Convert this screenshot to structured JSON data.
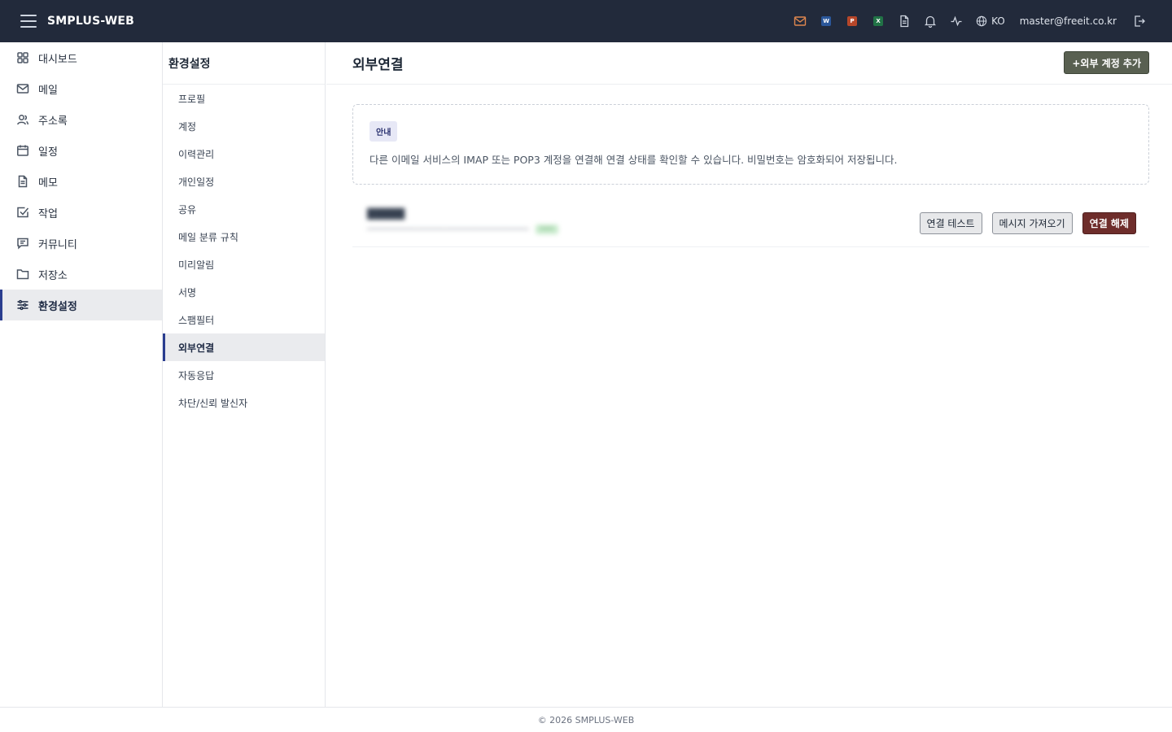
{
  "app": {
    "brand": "SMPLUS-WEB"
  },
  "topbar": {
    "word_letter": "W",
    "ppt_letter": "P",
    "excel_letter": "X",
    "language": "KO",
    "user_email": "master@freeit.co.kr",
    "colors": {
      "bg": "#222a3b",
      "mail_icon": "#e0874f",
      "word": "#2b579a",
      "ppt": "#b7472a",
      "excel": "#217346"
    }
  },
  "leftnav": {
    "items": [
      {
        "label": "대시보드",
        "icon": "grid-icon"
      },
      {
        "label": "메일",
        "icon": "mail-icon"
      },
      {
        "label": "주소록",
        "icon": "users-icon"
      },
      {
        "label": "일정",
        "icon": "calendar-icon"
      },
      {
        "label": "메모",
        "icon": "memo-icon"
      },
      {
        "label": "작업",
        "icon": "check-square-icon"
      },
      {
        "label": "커뮤니티",
        "icon": "chat-icon"
      },
      {
        "label": "저장소",
        "icon": "folder-icon"
      },
      {
        "label": "환경설정",
        "icon": "sliders-icon",
        "active": true
      }
    ]
  },
  "subnav": {
    "title": "환경설정",
    "items": [
      {
        "label": "프로필"
      },
      {
        "label": "계정"
      },
      {
        "label": "이력관리"
      },
      {
        "label": "개인일정"
      },
      {
        "label": "공유"
      },
      {
        "label": "메일 분류 규칙"
      },
      {
        "label": "미리알림"
      },
      {
        "label": "서명"
      },
      {
        "label": "스팸필터"
      },
      {
        "label": "외부연결",
        "active": true
      },
      {
        "label": "자동응답"
      },
      {
        "label": "차단/신뢰 발신자"
      }
    ]
  },
  "main": {
    "title": "외부연결",
    "add_button": "+외부 계정 추가",
    "notice": {
      "badge": "안내",
      "text": "다른 이메일 서비스의 IMAP 또는 POP3 계정을 연결해 연결 상태를 확인할 수 있습니다. 비밀번호는 암호화되어 저장됩니다."
    },
    "account": {
      "name": "",
      "meta": "",
      "status": "",
      "actions": {
        "test": "연결 테스트",
        "fetch": "메시지 가져오기",
        "disconnect": "연결 해제"
      }
    }
  },
  "footer": {
    "text": "© 2026 SMPLUS-WEB"
  }
}
